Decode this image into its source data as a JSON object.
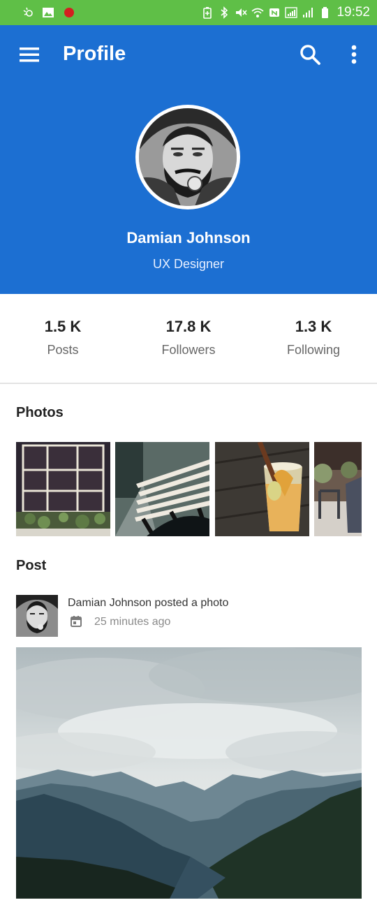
{
  "status_bar": {
    "time": "19:52",
    "left_icons": [
      "hotspot-icon",
      "image-icon",
      "record-dot-icon"
    ],
    "right_icons": [
      "battery-saver-icon",
      "bluetooth-icon",
      "mute-icon",
      "wifi-icon",
      "nfc-icon",
      "signal-icon",
      "signal-icon-2",
      "battery-icon"
    ],
    "bg_color": "#5fbf47"
  },
  "app_bar": {
    "title": "Profile",
    "menu_icon": "menu-icon",
    "search_icon": "search-icon",
    "more_icon": "more-vert-icon",
    "bg_color": "#1c6fd2"
  },
  "profile": {
    "name": "Damian Johnson",
    "role": "UX Designer"
  },
  "stats": [
    {
      "value": "1.5 K",
      "label": "Posts"
    },
    {
      "value": "17.8 K",
      "label": "Followers"
    },
    {
      "value": "1.3 K",
      "label": "Following"
    }
  ],
  "photos": {
    "title": "Photos"
  },
  "post": {
    "title": "Post",
    "author_text": "Damian Johnson posted a photo",
    "time": "25 minutes ago"
  }
}
